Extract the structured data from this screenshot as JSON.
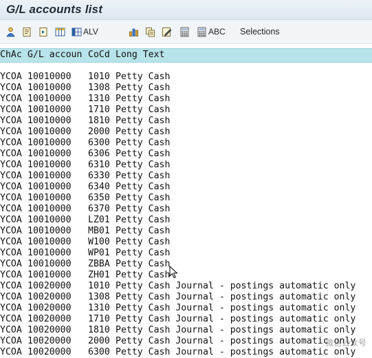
{
  "window": {
    "title": "G/L accounts list"
  },
  "toolbar": {
    "items": [
      {
        "icon": "person-icon",
        "label": ""
      },
      {
        "icon": "document-icon",
        "label": ""
      },
      {
        "icon": "document-next-icon",
        "label": ""
      },
      {
        "icon": "grid-icon",
        "label": ""
      },
      {
        "icon": "grid-columns-icon",
        "label": "ALV"
      },
      {
        "icon": "chart-icon",
        "label": ""
      },
      {
        "icon": "copy-icon",
        "label": ""
      },
      {
        "icon": "edit-icon",
        "label": ""
      },
      {
        "icon": "calculator-icon",
        "label": ""
      },
      {
        "icon": "calculator-abc-icon",
        "label": "ABC"
      }
    ],
    "selections_label": "Selections"
  },
  "list": {
    "columns": [
      "ChAc",
      "G/L accoun",
      "CoCd",
      "Long Text"
    ],
    "rows": [
      [
        "YCOA",
        "10010000",
        "1010",
        "Petty Cash"
      ],
      [
        "YCOA",
        "10010000",
        "1308",
        "Petty Cash"
      ],
      [
        "YCOA",
        "10010000",
        "1310",
        "Petty Cash"
      ],
      [
        "YCOA",
        "10010000",
        "1710",
        "Petty Cash"
      ],
      [
        "YCOA",
        "10010000",
        "1810",
        "Petty Cash"
      ],
      [
        "YCOA",
        "10010000",
        "2000",
        "Petty Cash"
      ],
      [
        "YCOA",
        "10010000",
        "6300",
        "Petty Cash"
      ],
      [
        "YCOA",
        "10010000",
        "6306",
        "Petty Cash"
      ],
      [
        "YCOA",
        "10010000",
        "6310",
        "Petty Cash"
      ],
      [
        "YCOA",
        "10010000",
        "6330",
        "Petty Cash"
      ],
      [
        "YCOA",
        "10010000",
        "6340",
        "Petty Cash"
      ],
      [
        "YCOA",
        "10010000",
        "6350",
        "Petty Cash"
      ],
      [
        "YCOA",
        "10010000",
        "6370",
        "Petty Cash"
      ],
      [
        "YCOA",
        "10010000",
        "LZ01",
        "Petty Cash"
      ],
      [
        "YCOA",
        "10010000",
        "MB01",
        "Petty Cash"
      ],
      [
        "YCOA",
        "10010000",
        "W100",
        "Petty Cash"
      ],
      [
        "YCOA",
        "10010000",
        "WP01",
        "Petty Cash"
      ],
      [
        "YCOA",
        "10010000",
        "ZBBA",
        "Petty Cash"
      ],
      [
        "YCOA",
        "10010000",
        "ZH01",
        "Petty Cash"
      ],
      [
        "YCOA",
        "10020000",
        "1010",
        "Petty Cash Journal - postings automatic only"
      ],
      [
        "YCOA",
        "10020000",
        "1308",
        "Petty Cash Journal - postings automatic only"
      ],
      [
        "YCOA",
        "10020000",
        "1310",
        "Petty Cash Journal - postings automatic only"
      ],
      [
        "YCOA",
        "10020000",
        "1710",
        "Petty Cash Journal - postings automatic only"
      ],
      [
        "YCOA",
        "10020000",
        "1810",
        "Petty Cash Journal - postings automatic only"
      ],
      [
        "YCOA",
        "10020000",
        "2000",
        "Petty Cash Journal - postings automatic only"
      ],
      [
        "YCOA",
        "10020000",
        "6300",
        "Petty Cash Journal - postings automatic only"
      ]
    ]
  },
  "colors": {
    "header_bg": "#b7e3ea",
    "toolbar_bg": "#f2f5f8",
    "title_bg": "#e6edf4"
  },
  "watermark": "微信公众号"
}
